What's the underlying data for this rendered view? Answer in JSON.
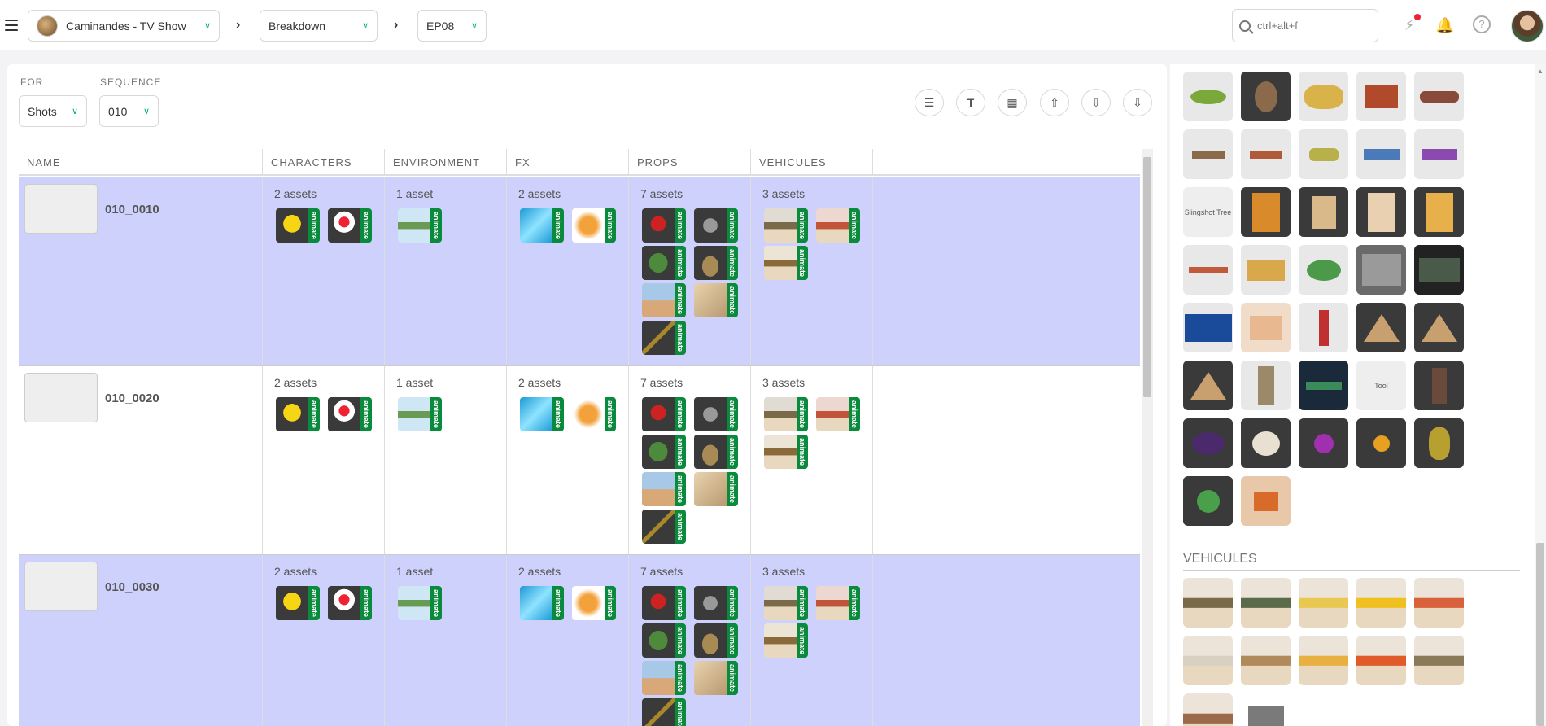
{
  "topbar": {
    "production": "Caminandes - TV Show",
    "section": "Breakdown",
    "episode": "EP08",
    "search_placeholder": "ctrl+alt+f"
  },
  "filters": {
    "for_label": "FOR",
    "for_value": "Shots",
    "sequence_label": "SEQUENCE",
    "sequence_value": "010"
  },
  "toolbar": {
    "icons": [
      "database-icon",
      "text-icon",
      "grid-icon",
      "upload-icon",
      "download-icon",
      "download-icon"
    ]
  },
  "table": {
    "columns": [
      "NAME",
      "CHARACTERS",
      "ENVIRONMENT",
      "FX",
      "PROPS",
      "VEHICULES"
    ],
    "tag": "animate",
    "rows": [
      {
        "name": "010_0010",
        "selected": true,
        "characters": "2 assets",
        "environment": "1 asset",
        "fx": "2 assets",
        "props": "7 assets",
        "vehicules": "3 assets"
      },
      {
        "name": "010_0020",
        "selected": false,
        "characters": "2 assets",
        "environment": "1 asset",
        "fx": "2 assets",
        "props": "7 assets",
        "vehicules": "3 assets"
      },
      {
        "name": "010_0030",
        "selected": true,
        "characters": "2 assets",
        "environment": "1 asset",
        "fx": "2 assets",
        "props": "7 assets",
        "vehicules": "3 assets"
      }
    ]
  },
  "side": {
    "slingshot_label": "Slingshot Tree",
    "tool_label": "Tool",
    "vehicules_heading": "VEHICULES"
  },
  "colors": {
    "selected_row": "#cdd1fb",
    "tag_green": "#0a8a3c",
    "accent": "#00b36b"
  }
}
